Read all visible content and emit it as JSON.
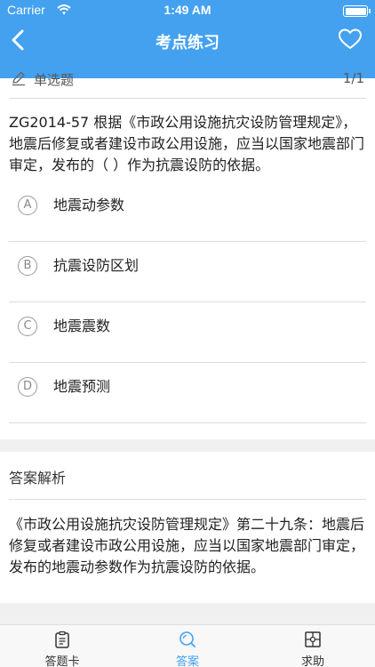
{
  "status_bar": {
    "carrier": "Carrier",
    "time": "1:49 AM"
  },
  "nav": {
    "title": "考点练习",
    "back_icon": "chevron-left-icon",
    "favorite_icon": "heart-outline-icon"
  },
  "question": {
    "type": "单选题",
    "counter": "1/1",
    "stem": "ZG2014-57 根据《市政公用设施抗灾设防管理规定》，地震后修复或者建设市政公用设施，应当以国家地震部门审定，发布的（  ）作为抗震设防的依据。",
    "options": [
      {
        "letter": "A",
        "text": "地震动参数"
      },
      {
        "letter": "B",
        "text": "抗震设防区划"
      },
      {
        "letter": "C",
        "text": "地震震数"
      },
      {
        "letter": "D",
        "text": "地震预测"
      }
    ]
  },
  "analysis": {
    "title": "答案解析",
    "text": "《市政公用设施抗灾设防管理规定》第二十九条：地震后修复或者建设市政公用设施，应当以国家地震部门审定，发布的地震动参数作为抗震设防的依据。"
  },
  "tabbar": {
    "items": [
      {
        "label": "答题卡",
        "icon": "clipboard-icon"
      },
      {
        "label": "答案",
        "icon": "search-icon"
      },
      {
        "label": "求助",
        "icon": "puzzle-icon"
      }
    ],
    "active_index": 1,
    "active_color": "#43a1f0"
  },
  "colors": {
    "header": "#43a1f0",
    "background": "#ffffff",
    "divider": "#dcdcdc"
  }
}
